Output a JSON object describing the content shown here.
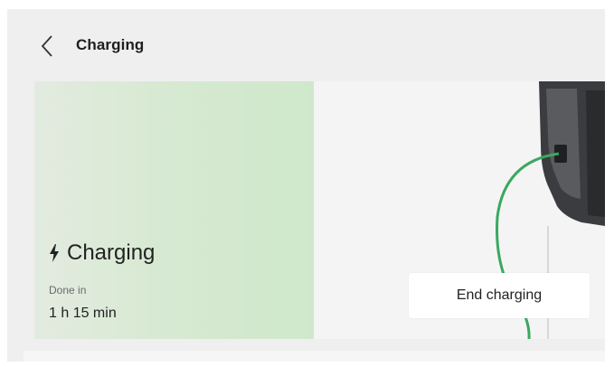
{
  "header": {
    "title": "Charging",
    "back_icon": "chevron-left-icon"
  },
  "status": {
    "label": "Charging",
    "icon": "lightning-bolt-icon"
  },
  "eta": {
    "label": "Done in",
    "value": "1 h 15 min"
  },
  "actions": {
    "end_charging": "End charging"
  },
  "colors": {
    "panel_green": "#d7e9d2",
    "cable_green": "#3aa860"
  }
}
